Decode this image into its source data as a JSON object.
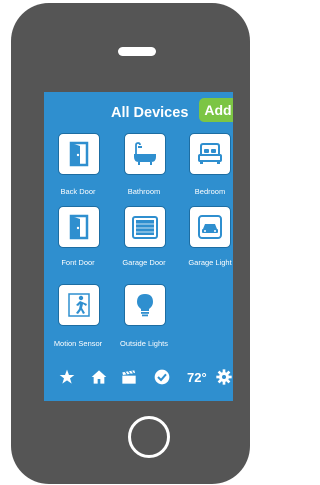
{
  "header": {
    "title": "All Devices",
    "add_label": "Add"
  },
  "devices": [
    {
      "label": "Back Door",
      "icon": "door-icon"
    },
    {
      "label": "Bathroom",
      "icon": "bathtub-icon"
    },
    {
      "label": "Bedroom",
      "icon": "bed-icon"
    },
    {
      "label": "Font Door",
      "icon": "door-icon"
    },
    {
      "label": "Garage Door",
      "icon": "garage-door-icon"
    },
    {
      "label": "Garage Light",
      "icon": "garage-car-icon"
    },
    {
      "label": "Motion Sensor",
      "icon": "running-person-icon"
    },
    {
      "label": "Outside Lights",
      "icon": "lightbulb-icon"
    }
  ],
  "bottom_bar": {
    "icons": [
      "star-icon",
      "home-icon",
      "clapperboard-icon",
      "checkmark-circle-icon",
      "gear-icon"
    ],
    "temperature": "72°"
  },
  "colors": {
    "screen": "#2f8fcf",
    "phone_body": "#555555",
    "add_button": "#7cc544"
  }
}
